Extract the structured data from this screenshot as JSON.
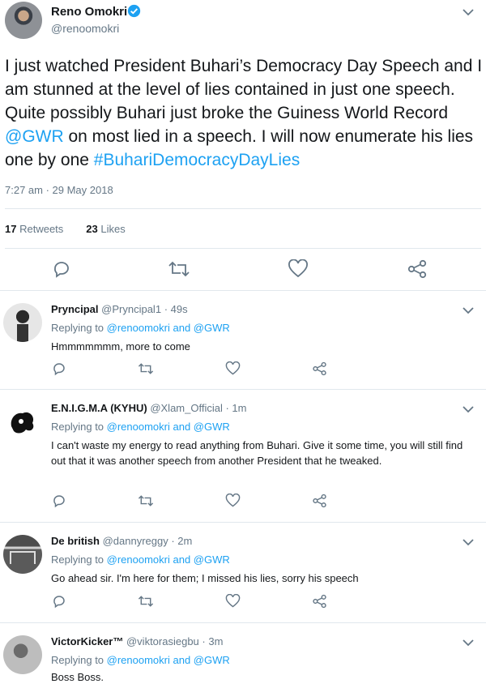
{
  "main_tweet": {
    "author_name": "Reno Omokri",
    "author_handle": "@renoomokri",
    "text_parts": [
      "I just watched President Buhari’s Democracy Day Speech and I am stunned at the level of lies contained in just one speech. Quite possibly Buhari just broke the Guiness World Record ",
      "@GWR",
      " on most lied in a speech. I will now enumerate his lies one by one ",
      "#BuhariDemocracyDayLies"
    ],
    "timestamp": "7:27 am · 29 May 2018",
    "retweets_count": "17",
    "retweets_label": "Retweets",
    "likes_count": "23",
    "likes_label": "Likes"
  },
  "replies": [
    {
      "name": "Pryncipal",
      "handle": "@Pryncipal1",
      "time": "· 49s",
      "replying_prefix": "Replying to ",
      "replying_targets": "@renoomokri and @GWR",
      "text": "Hmmmmmmm, more to come"
    },
    {
      "name": "E.N.I.G.M.A (KYHU)",
      "handle": "@Xlam_Official",
      "time": "· 1m",
      "replying_prefix": "Replying to ",
      "replying_targets": "@renoomokri and @GWR",
      "text": "I can't waste my energy to read anything from Buhari. Give it some time, you will still find out that it was another speech from another President that he tweaked."
    },
    {
      "name": "De british",
      "handle": "@dannyreggy",
      "time": "· 2m",
      "replying_prefix": "Replying to ",
      "replying_targets": "@renoomokri and @GWR",
      "text": "Go ahead sir. I'm here for them; I missed his lies, sorry his speech"
    },
    {
      "name": "VictorKicker™",
      "handle": "@viktorasiegbu",
      "time": "· 3m",
      "replying_prefix": "Replying to ",
      "replying_targets": "@renoomokri and @GWR",
      "text": "Boss Boss."
    }
  ],
  "icons": {
    "reply": "reply-icon",
    "retweet": "retweet-icon",
    "like": "heart-icon",
    "share": "share-icon",
    "menu": "chevron-down-icon",
    "verified": "verified-badge-icon"
  },
  "colors": {
    "link": "#1da1f2",
    "secondary": "#657786",
    "divider": "#e1e8ed"
  }
}
